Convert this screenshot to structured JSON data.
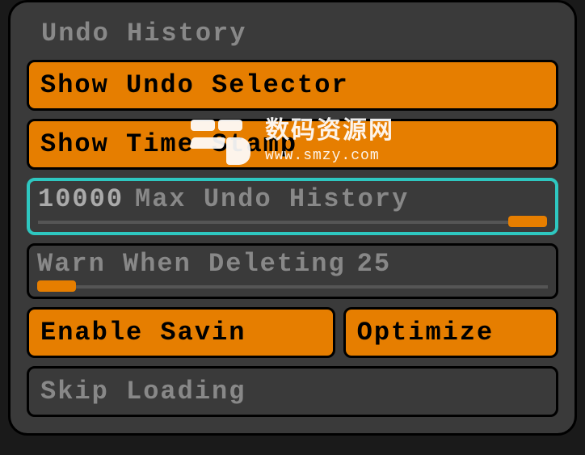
{
  "panel": {
    "title": "Undo History",
    "buttons": {
      "show_selector": "Show Undo Selector",
      "show_timestamp": "Show Time Stamp",
      "enable_saving": "Enable Savin",
      "optimize": "Optimize",
      "skip_loading": "Skip Loading"
    },
    "sliders": {
      "max_undo": {
        "value": "10000",
        "label": "Max Undo History",
        "pos": "right"
      },
      "warn_del": {
        "label": "Warn When Deleting",
        "value": "25",
        "pos": "left"
      }
    }
  },
  "watermark": {
    "cn": "数码资源网",
    "url": "www.smzy.com"
  }
}
